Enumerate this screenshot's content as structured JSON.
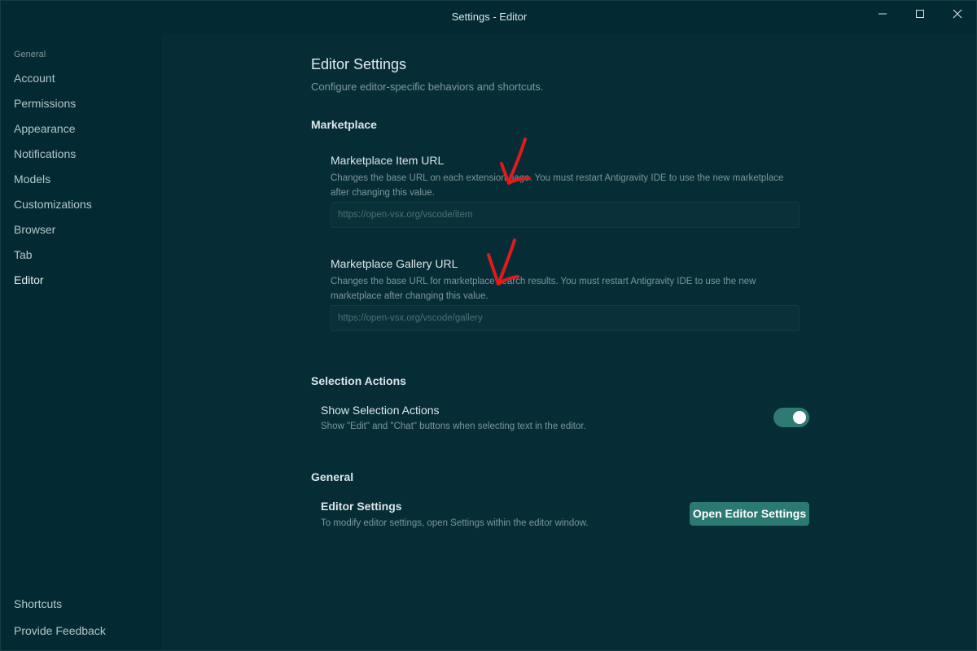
{
  "window": {
    "title": "Settings - Editor"
  },
  "sidebar": {
    "section_label": "General",
    "items": [
      {
        "label": "Account"
      },
      {
        "label": "Permissions"
      },
      {
        "label": "Appearance"
      },
      {
        "label": "Notifications"
      },
      {
        "label": "Models"
      },
      {
        "label": "Customizations"
      },
      {
        "label": "Browser"
      },
      {
        "label": "Tab"
      },
      {
        "label": "Editor",
        "active": true
      }
    ],
    "bottom_items": [
      {
        "label": "Shortcuts"
      },
      {
        "label": "Provide Feedback"
      }
    ]
  },
  "page": {
    "title": "Editor Settings",
    "subtitle": "Configure editor-specific behaviors and shortcuts."
  },
  "marketplace": {
    "heading": "Marketplace",
    "item_url": {
      "label": "Marketplace Item URL",
      "description": "Changes the base URL on each extension page. You must restart Antigravity IDE to use the new marketplace after changing this value.",
      "placeholder": "https://open-vsx.org/vscode/item",
      "value": ""
    },
    "gallery_url": {
      "label": "Marketplace Gallery URL",
      "description": "Changes the base URL for marketplace search results. You must restart Antigravity IDE to use the new marketplace after changing this value.",
      "placeholder": "https://open-vsx.org/vscode/gallery",
      "value": ""
    }
  },
  "selection_actions": {
    "heading": "Selection Actions",
    "label": "Show Selection Actions",
    "description": "Show \"Edit\" and \"Chat\" buttons when selecting text in the editor.",
    "enabled": true
  },
  "general": {
    "heading": "General",
    "label": "Editor Settings",
    "description": "To modify editor settings, open Settings within the editor window.",
    "button_label": "Open Editor Settings"
  },
  "colors": {
    "background": "#062d36",
    "sidebar": "#032a33",
    "accent": "#2b7a72",
    "annotation": "#e01b1b"
  },
  "icons": {
    "minimize": "minimize-icon",
    "maximize": "maximize-icon",
    "close": "close-icon",
    "annotation": "red-arrow-annotation"
  }
}
